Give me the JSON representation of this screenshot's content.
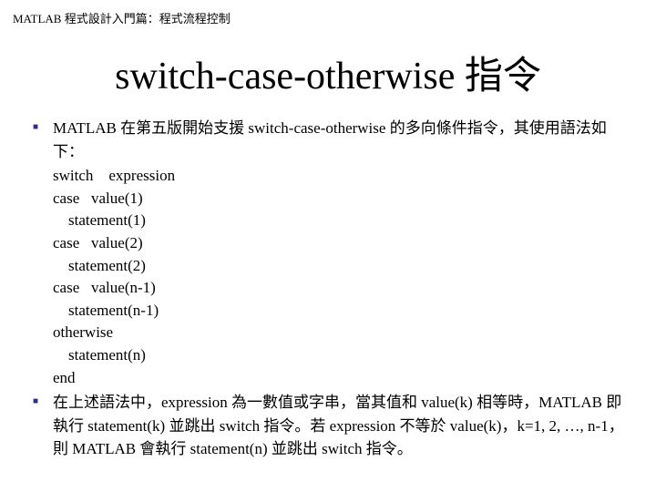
{
  "header": "MATLAB 程式設計入門篇：程式流程控制",
  "title": "switch-case-otherwise 指令",
  "bullets": {
    "b1": "MATLAB 在第五版開始支援 switch-case-otherwise 的多向條件指令，其使用語法如下：",
    "b2": "在上述語法中，expression 為一數值或字串，當其值和 value(k) 相等時，MATLAB 即執行 statement(k) 並跳出 switch 指令。若 expression 不等於 value(k)，k=1, 2, …, n-1，則 MATLAB 會執行 statement(n) 並跳出 switch 指令。"
  },
  "code": {
    "l1": "switch    expression",
    "l2": "case   value(1)",
    "l3": "    statement(1)",
    "l4": "case   value(2)",
    "l5": "    statement(2)",
    "l6": "case   value(n-1)",
    "l7": "    statement(n-1)",
    "l8": "otherwise",
    "l9": "    statement(n)",
    "l10": "end"
  }
}
